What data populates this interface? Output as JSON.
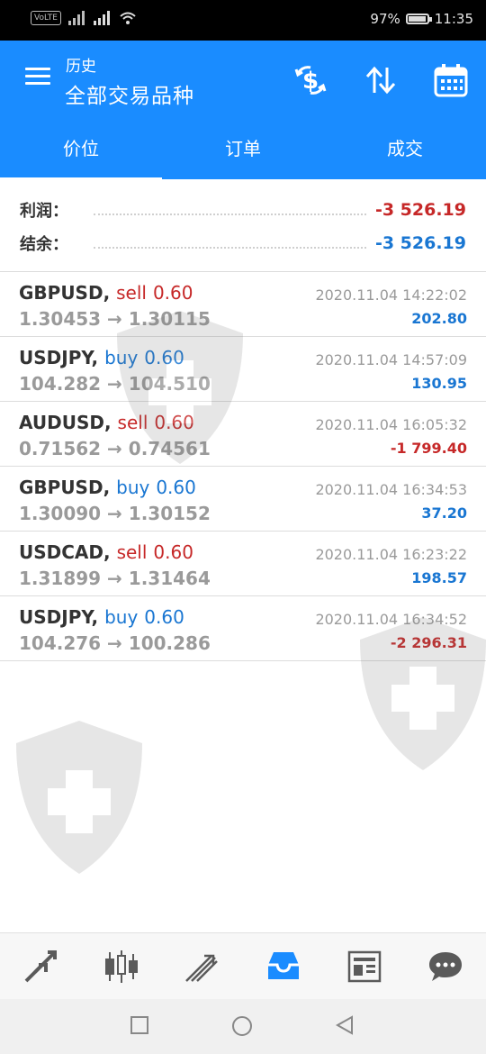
{
  "status_bar": {
    "volte": "VoLTE",
    "battery": "97%",
    "time": "11:35",
    "battery_level": 0.97
  },
  "app_bar": {
    "subtitle": "历史",
    "title": "全部交易品种",
    "icons": [
      "menu-icon",
      "currency-icon",
      "sort-icon",
      "calendar-icon"
    ]
  },
  "tabs": [
    {
      "label": "价位",
      "active": true
    },
    {
      "label": "订单",
      "active": false
    },
    {
      "label": "成交",
      "active": false
    }
  ],
  "summary": {
    "profit_label": "利润：",
    "profit_value": "-3 526.19",
    "balance_label": "结余：",
    "balance_value": "-3 526.19"
  },
  "deals": [
    {
      "symbol": "GBPUSD,",
      "side": "sell",
      "volume": "0.60",
      "prices": "1.30453 → 1.30115",
      "time": "2020.11.04 14:22:02",
      "profit": "202.80"
    },
    {
      "symbol": "USDJPY,",
      "side": "buy",
      "volume": "0.60",
      "prices": "104.282 → 104.510",
      "time": "2020.11.04 14:57:09",
      "profit": "130.95"
    },
    {
      "symbol": "AUDUSD,",
      "side": "sell",
      "volume": "0.60",
      "prices": "0.71562 → 0.74561",
      "time": "2020.11.04 16:05:32",
      "profit": "-1 799.40"
    },
    {
      "symbol": "GBPUSD,",
      "side": "buy",
      "volume": "0.60",
      "prices": "1.30090 → 1.30152",
      "time": "2020.11.04 16:34:53",
      "profit": "37.20"
    },
    {
      "symbol": "USDCAD,",
      "side": "sell",
      "volume": "0.60",
      "prices": "1.31899 → 1.31464",
      "time": "2020.11.04 16:23:22",
      "profit": "198.57"
    },
    {
      "symbol": "USDJPY,",
      "side": "buy",
      "volume": "0.60",
      "prices": "104.276 → 100.286",
      "time": "2020.11.04 16:34:52",
      "profit": "-2 296.31"
    }
  ],
  "bottom_nav": [
    {
      "icon": "quotes-arrows-icon",
      "active": false
    },
    {
      "icon": "candlestick-chart-icon",
      "active": false
    },
    {
      "icon": "trade-icon",
      "active": false
    },
    {
      "icon": "history-inbox-icon",
      "active": true
    },
    {
      "icon": "news-icon",
      "active": false
    },
    {
      "icon": "chat-icon",
      "active": false
    }
  ],
  "colors": {
    "accent": "#1a8cff",
    "loss": "#c62828",
    "gain": "#1976d2",
    "muted": "#9a9a9a"
  }
}
